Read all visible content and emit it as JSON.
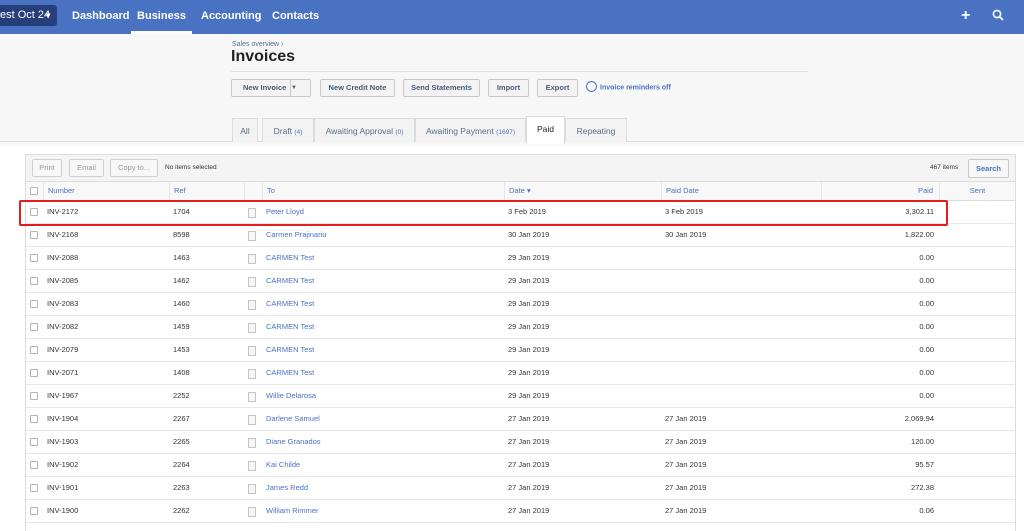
{
  "nav": {
    "org": "est Oct 24",
    "links": [
      "Dashboard",
      "Business",
      "Accounting",
      "Contacts"
    ],
    "add_icon": "plus-icon",
    "search_icon": "search-icon"
  },
  "header": {
    "breadcrumb": "Sales overview ›",
    "title": "Invoices"
  },
  "actions": {
    "new_invoice": "New Invoice",
    "new_credit_note": "New Credit Note",
    "send_statements": "Send Statements",
    "import": "Import",
    "export": "Export",
    "reminders": "Invoice reminders off"
  },
  "tabs": [
    {
      "label": "All",
      "count": ""
    },
    {
      "label": "Draft",
      "count": "(4)"
    },
    {
      "label": "Awaiting Approval",
      "count": "(0)"
    },
    {
      "label": "Awaiting Payment",
      "count": "(1697)"
    },
    {
      "label": "Paid",
      "count": ""
    },
    {
      "label": "Repeating",
      "count": ""
    }
  ],
  "toolbar": {
    "print": "Print",
    "email": "Email",
    "copy_to": "Copy to...",
    "selection": "No items selected",
    "item_count": "467 items",
    "search": "Search"
  },
  "columns": {
    "number": "Number",
    "ref": "Ref",
    "to": "To",
    "date": "Date ▾",
    "paid_date": "Paid Date",
    "paid": "Paid",
    "sent": "Sent"
  },
  "rows": [
    {
      "number": "INV-2172",
      "ref": "1704",
      "to": "Peter Lloyd",
      "date": "3 Feb 2019",
      "paid_date": "3 Feb 2019",
      "paid": "3,302.11"
    },
    {
      "number": "INV-2168",
      "ref": "8598",
      "to": "Carmen Prajinariu",
      "date": "30 Jan 2019",
      "paid_date": "30 Jan 2019",
      "paid": "1,822.00"
    },
    {
      "number": "INV-2088",
      "ref": "1463",
      "to": "CARMEN Test",
      "date": "29 Jan 2019",
      "paid_date": "",
      "paid": "0.00"
    },
    {
      "number": "INV-2085",
      "ref": "1462",
      "to": "CARMEN Test",
      "date": "29 Jan 2019",
      "paid_date": "",
      "paid": "0.00"
    },
    {
      "number": "INV-2083",
      "ref": "1460",
      "to": "CARMEN Test",
      "date": "29 Jan 2019",
      "paid_date": "",
      "paid": "0.00"
    },
    {
      "number": "INV-2082",
      "ref": "1459",
      "to": "CARMEN Test",
      "date": "29 Jan 2019",
      "paid_date": "",
      "paid": "0.00"
    },
    {
      "number": "INV-2079",
      "ref": "1453",
      "to": "CARMEN Test",
      "date": "29 Jan 2019",
      "paid_date": "",
      "paid": "0.00"
    },
    {
      "number": "INV-2071",
      "ref": "1408",
      "to": "CARMEN Test",
      "date": "29 Jan 2019",
      "paid_date": "",
      "paid": "0.00"
    },
    {
      "number": "INV-1967",
      "ref": "2252",
      "to": "Willie Delarosa",
      "date": "29 Jan 2019",
      "paid_date": "",
      "paid": "0.00"
    },
    {
      "number": "INV-1904",
      "ref": "2267",
      "to": "Darlene Samuel",
      "date": "27 Jan 2019",
      "paid_date": "27 Jan 2019",
      "paid": "2,069.94"
    },
    {
      "number": "INV-1903",
      "ref": "2265",
      "to": "Diane Granados",
      "date": "27 Jan 2019",
      "paid_date": "27 Jan 2019",
      "paid": "120.00"
    },
    {
      "number": "INV-1902",
      "ref": "2264",
      "to": "Kai Childe",
      "date": "27 Jan 2019",
      "paid_date": "27 Jan 2019",
      "paid": "95.57"
    },
    {
      "number": "INV-1901",
      "ref": "2263",
      "to": "James Redd",
      "date": "27 Jan 2019",
      "paid_date": "27 Jan 2019",
      "paid": "272.38"
    },
    {
      "number": "INV-1900",
      "ref": "2262",
      "to": "William Rimmer",
      "date": "27 Jan 2019",
      "paid_date": "27 Jan 2019",
      "paid": "0.06"
    }
  ]
}
